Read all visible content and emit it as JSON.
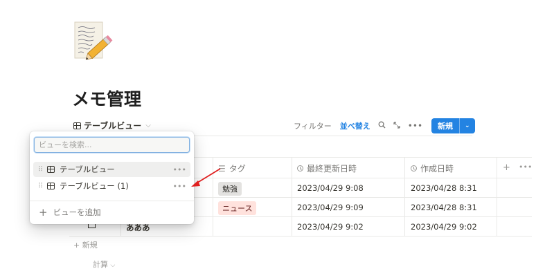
{
  "page": {
    "title": "メモ管理"
  },
  "view_switch": {
    "label": "テーブルビュー"
  },
  "toolbar": {
    "filter": "フィルター",
    "sort": "並べ替え",
    "new_label": "新規"
  },
  "table": {
    "columns": [
      "タグ",
      "最終更新日時",
      "作成日時"
    ],
    "rows": [
      {
        "name": "",
        "tag": "勉強",
        "updated": "2023/04/29 9:08",
        "created": "2023/04/28 8:31"
      },
      {
        "name": "",
        "tag": "ニュース",
        "updated": "2023/04/29 9:09",
        "created": "2023/04/28 8:31"
      },
      {
        "name": "あああ",
        "tag": "",
        "updated": "2023/04/29 9:02",
        "created": "2023/04/29 9:02"
      }
    ],
    "new_row": "新規",
    "calculate": "計算"
  },
  "view_menu": {
    "search_placeholder": "ビューを検索...",
    "items": [
      {
        "label": "テーブルビュー"
      },
      {
        "label": "テーブルビュー (1)"
      }
    ],
    "add_view": "ビューを追加"
  },
  "colors": {
    "accent": "#2383e2",
    "tag_study_bg": "#e3e2e0",
    "tag_news_bg": "#ffe2dd",
    "annotation_arrow": "#e02020"
  },
  "icons": [
    "memo-pencil-icon",
    "table-icon",
    "search-icon",
    "expand-icon",
    "more-icon",
    "clock-icon",
    "drag-handle-icon",
    "plus-icon",
    "chevron-down-icon"
  ]
}
